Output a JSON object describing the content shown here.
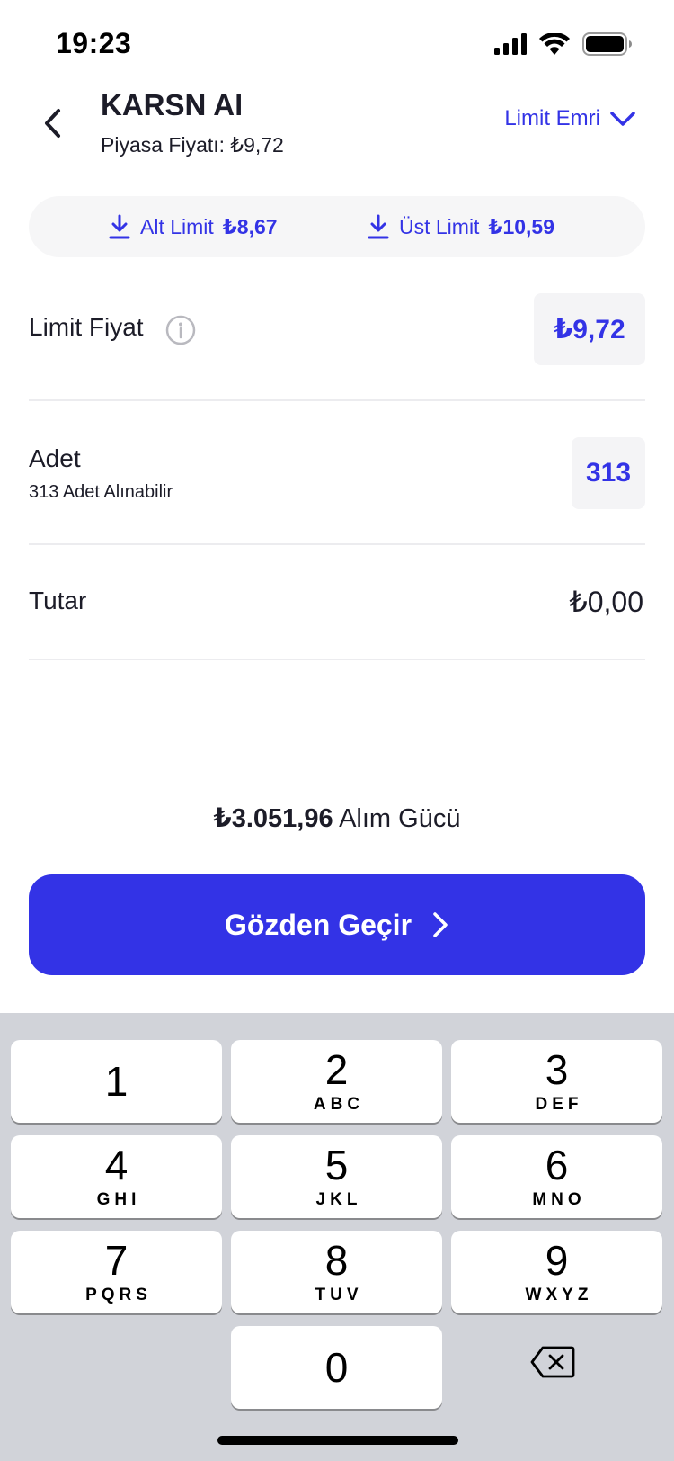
{
  "status_bar": {
    "time": "19:23"
  },
  "header": {
    "title": "KARSN Al",
    "subtitle": "Piyasa Fiyatı: ₺9,72",
    "order_type": "Limit Emri"
  },
  "limits": {
    "alt_label": "Alt Limit",
    "alt_value": "₺8,67",
    "ust_label": "Üst Limit",
    "ust_value": "₺10,59"
  },
  "limit_price": {
    "label": "Limit Fiyat",
    "value": "₺9,72"
  },
  "quantity": {
    "label": "Adet",
    "sub": "313 Adet Alınabilir",
    "value": "313"
  },
  "amount": {
    "label": "Tutar",
    "value": "₺0,00"
  },
  "buying_power": {
    "amount": "₺3.051,96",
    "label": "Alım Gücü"
  },
  "cta": {
    "label": "Gözden Geçir"
  },
  "keypad": [
    {
      "num": "1",
      "letters": ""
    },
    {
      "num": "2",
      "letters": "ABC"
    },
    {
      "num": "3",
      "letters": "DEF"
    },
    {
      "num": "4",
      "letters": "GHI"
    },
    {
      "num": "5",
      "letters": "JKL"
    },
    {
      "num": "6",
      "letters": "MNO"
    },
    {
      "num": "7",
      "letters": "PQRS"
    },
    {
      "num": "8",
      "letters": "TUV"
    },
    {
      "num": "9",
      "letters": "WXYZ"
    },
    {
      "num": "0",
      "letters": ""
    }
  ],
  "colors": {
    "accent": "#3333e6",
    "text": "#1c1c28",
    "keyboard_bg": "#d1d3d9"
  },
  "icons": [
    "back-chevron-icon",
    "chevron-down-icon",
    "download-icon",
    "info-icon",
    "chevron-right-icon",
    "backspace-icon",
    "signal-icon",
    "wifi-icon",
    "battery-icon"
  ]
}
